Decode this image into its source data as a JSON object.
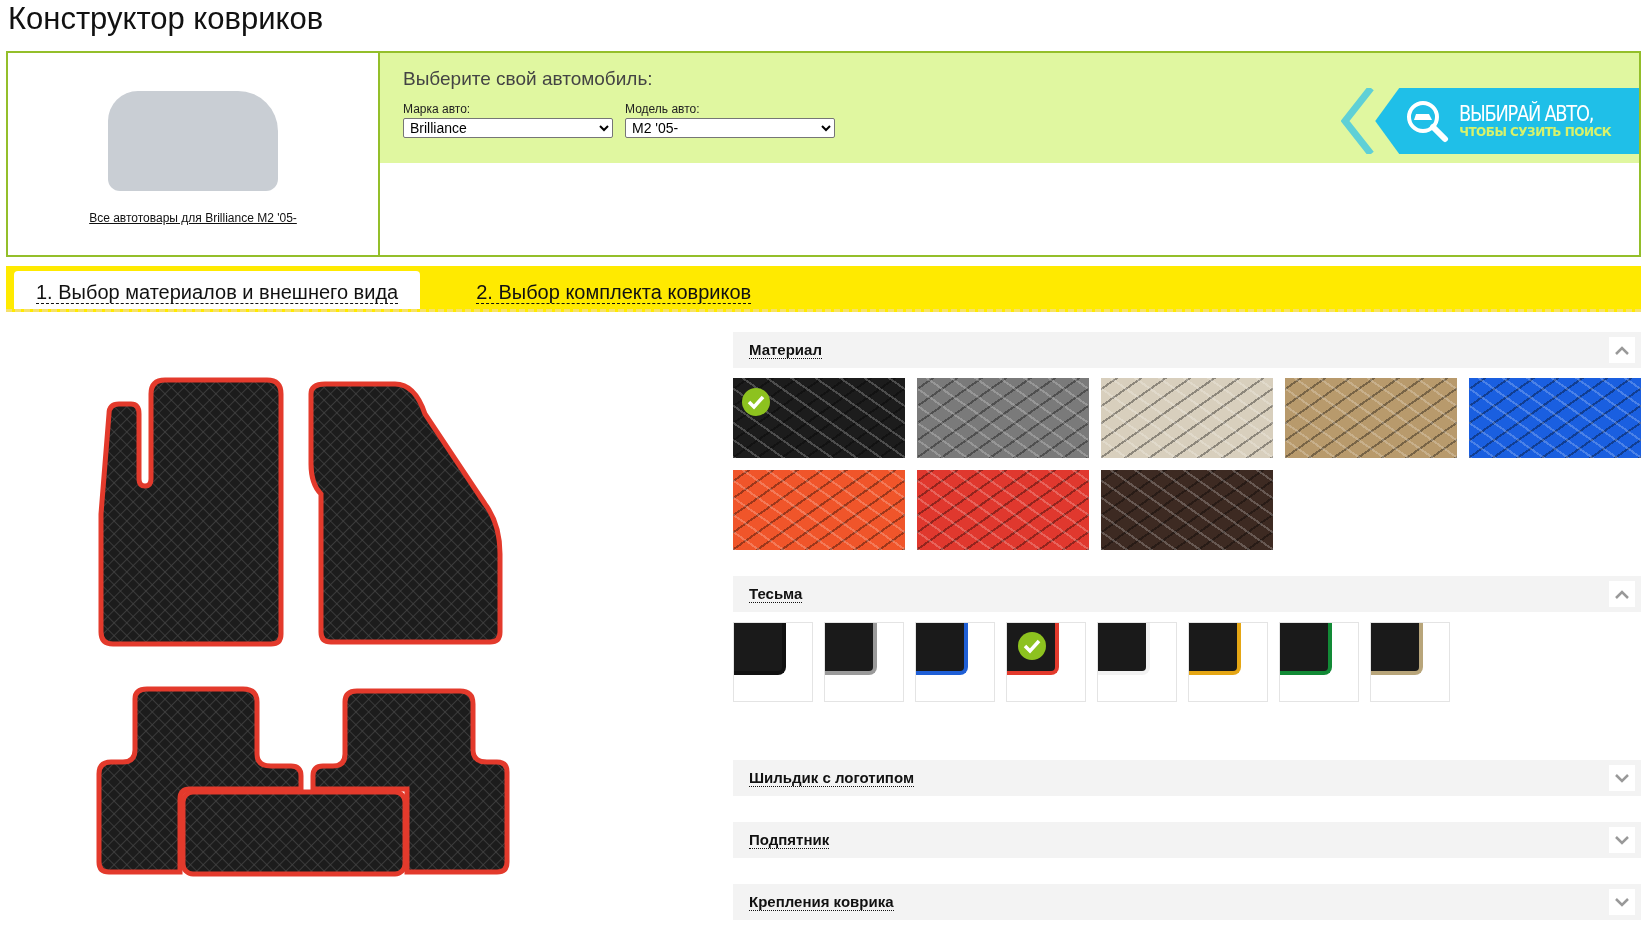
{
  "page_title": "Конструктор ковриков",
  "car": {
    "link": "Все автотовары для Brilliance M2 '05-"
  },
  "selector": {
    "heading": "Выберите свой автомобиль:",
    "fields": [
      {
        "label": "Марка авто:",
        "value": "Brilliance"
      },
      {
        "label": "Модель авто:",
        "value": "M2 '05-"
      }
    ],
    "banner": {
      "title": "ВЫБИРАЙ АВТО,",
      "subtitle": "ЧТОБЫ СУЗИТЬ ПОИСК"
    }
  },
  "tabs": [
    {
      "label": "1. Выбор материалов и внешнего вида",
      "selected": true
    },
    {
      "label": "2. Выбор комплекта ковриков",
      "selected": false
    }
  ],
  "sections": [
    {
      "title": "Материал",
      "expanded": true,
      "kind": "material",
      "options": [
        {
          "color": "#1c1c1c",
          "selected": true
        },
        {
          "color": "#7a7a7a",
          "selected": false
        },
        {
          "color": "#d8cfbd",
          "selected": false
        },
        {
          "color": "#b89a6c",
          "selected": false
        },
        {
          "color": "#1a5fe0",
          "selected": false
        },
        {
          "color": "#f0552a",
          "selected": false
        },
        {
          "color": "#e0382e",
          "selected": false
        },
        {
          "color": "#3d2a22",
          "selected": false
        }
      ]
    },
    {
      "title": "Тесьма",
      "expanded": true,
      "kind": "edging",
      "options": [
        {
          "color": "#111111",
          "selected": false
        },
        {
          "color": "#9a9a9a",
          "selected": false
        },
        {
          "color": "#1f5fd6",
          "selected": false
        },
        {
          "color": "#e33a2c",
          "selected": true
        },
        {
          "color": "#f2f2f2",
          "selected": false
        },
        {
          "color": "#e5a614",
          "selected": false
        },
        {
          "color": "#128a36",
          "selected": false
        },
        {
          "color": "#b8a57a",
          "selected": false
        }
      ]
    },
    {
      "title": "Шильдик с логотипом",
      "expanded": false,
      "kind": "collapsed"
    },
    {
      "title": "Подпятник",
      "expanded": false,
      "kind": "collapsed"
    },
    {
      "title": "Крепления коврика",
      "expanded": false,
      "kind": "collapsed"
    }
  ]
}
